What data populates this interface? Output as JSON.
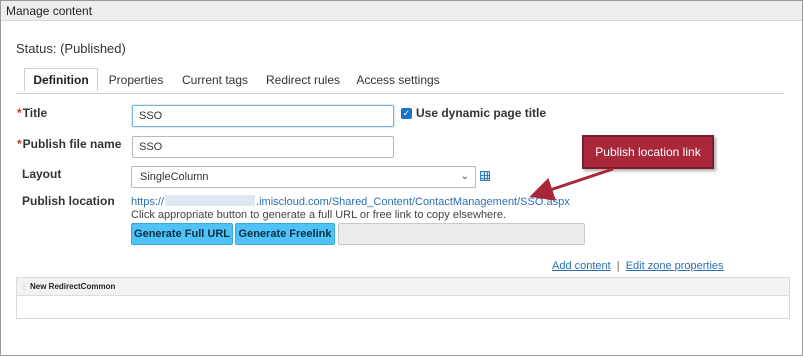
{
  "window": {
    "title": "Manage content"
  },
  "status": "Status: (Published)",
  "tabs": [
    {
      "label": "Definition",
      "active": true
    },
    {
      "label": "Properties",
      "active": false
    },
    {
      "label": "Current tags",
      "active": false
    },
    {
      "label": "Redirect rules",
      "active": false
    },
    {
      "label": "Access settings",
      "active": false
    }
  ],
  "form": {
    "title": {
      "label": "Title",
      "required_mark": "*",
      "value": "SSO"
    },
    "dynamic_title": {
      "label": "Use dynamic page title",
      "checked": true
    },
    "publish_file_name": {
      "label": "Publish file name",
      "required_mark": "*",
      "value": "SSO"
    },
    "layout": {
      "label": "Layout",
      "selected": "SingleColumn"
    },
    "publish_location": {
      "label": "Publish location",
      "url_prefix": "https://",
      "url_suffix": ".imiscloud.com/Shared_Content/ContactManagement/SSO.aspx",
      "help_text": "Click appropriate button to generate a full URL or free link to copy elsewhere."
    }
  },
  "buttons": {
    "generate_full_url": "Generate Full URL",
    "generate_freelink": "Generate Freelink"
  },
  "links": {
    "add_content": "Add content",
    "separator": "|",
    "edit_zone_properties": "Edit zone properties"
  },
  "zone": {
    "header": "New RedirectCommon"
  },
  "annotation": {
    "callout_text": "Publish location link"
  },
  "colors": {
    "accent_button": "#4fc3f7",
    "link": "#2a6fb0",
    "callout": "#a8283a",
    "checkbox": "#1a73c8"
  },
  "icons": {
    "dropdown": "chevron-down-icon",
    "layout_grid": "grid-icon",
    "checkbox": "checkmark-icon"
  }
}
